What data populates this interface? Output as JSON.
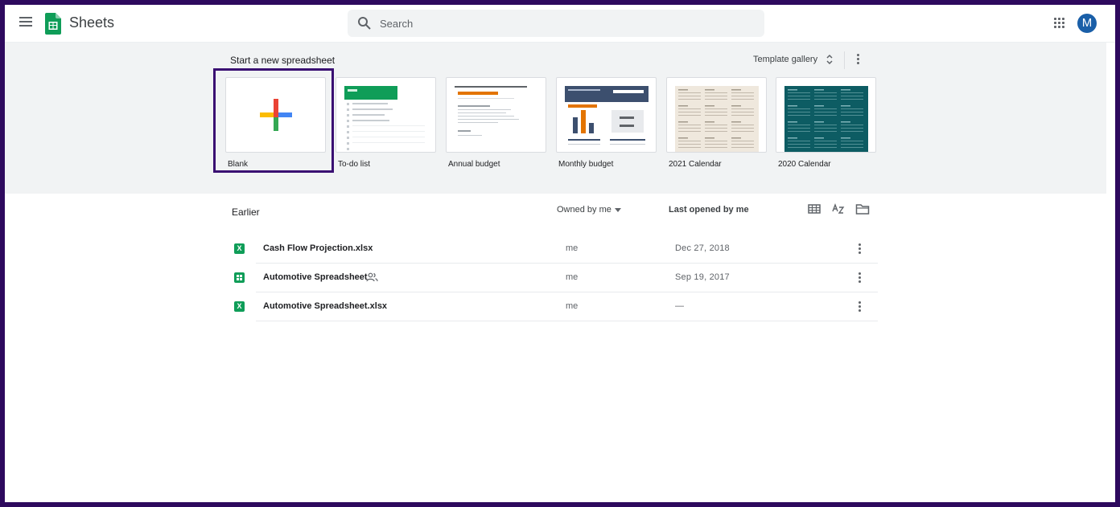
{
  "app": {
    "title": "Sheets",
    "avatar_letter": "M",
    "brand_color": "#0f9d58",
    "highlight_color": "#3a0f72"
  },
  "search": {
    "placeholder": "Search"
  },
  "templates": {
    "heading": "Start a new spreadsheet",
    "gallery_label": "Template gallery",
    "items": [
      {
        "label": "Blank"
      },
      {
        "label": "To-do list"
      },
      {
        "label": "Annual budget"
      },
      {
        "label": "Monthly budget"
      },
      {
        "label": "2021 Calendar"
      },
      {
        "label": "2020 Calendar"
      }
    ]
  },
  "files": {
    "section_title": "Earlier",
    "owner_filter": "Owned by me",
    "sort_label": "Last opened by me",
    "rows": [
      {
        "name": "Cash Flow Projection.xlsx",
        "owner": "me",
        "date": "Dec 27, 2018",
        "icon": "excel-icon",
        "icon_letter": "X",
        "shared": false
      },
      {
        "name": "Automotive Spreadsheet",
        "owner": "me",
        "date": "Sep 19, 2017",
        "icon": "sheets-icon",
        "icon_letter": "",
        "shared": true
      },
      {
        "name": "Automotive Spreadsheet.xlsx",
        "owner": "me",
        "date": "—",
        "icon": "excel-icon",
        "icon_letter": "X",
        "shared": false
      }
    ]
  }
}
